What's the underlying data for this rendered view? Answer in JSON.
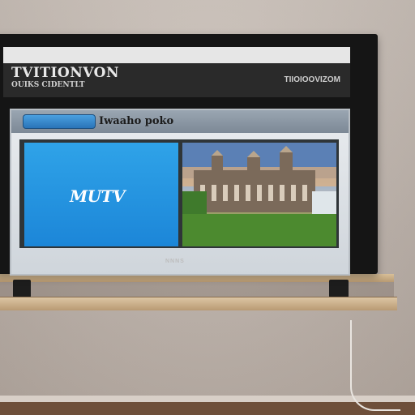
{
  "header": {
    "brand_title": "TVITIONVON",
    "brand_subtitle": "OUIKS CIDENTLT",
    "right_text": "TIIOIOOVIZOM"
  },
  "panel": {
    "button_label": "",
    "title": "Iwaaho poko"
  },
  "blue_pane": {
    "logo": "MUTV",
    "top_line": "",
    "tag": "",
    "bottom_line": ""
  },
  "tv_brand": "NNNS",
  "colors": {
    "panel_accent": "#2a74b8",
    "blue_pane": "#1c86d8",
    "tv_bezel": "#151515"
  }
}
